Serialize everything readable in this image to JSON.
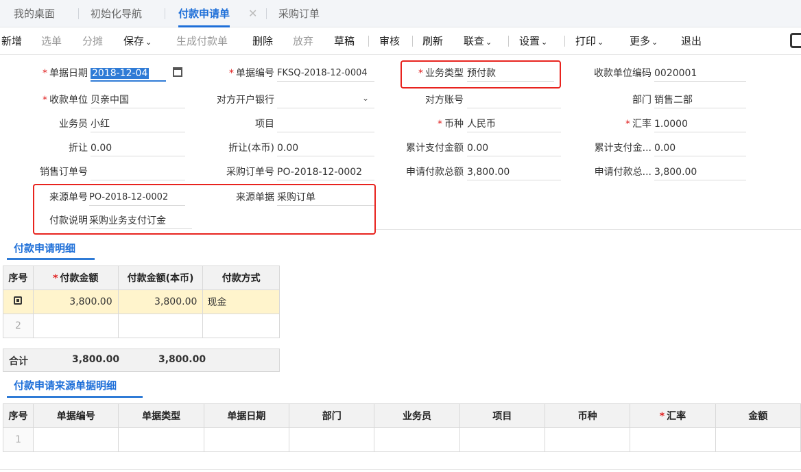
{
  "tabs": [
    {
      "label": "我的桌面"
    },
    {
      "label": "初始化导航"
    },
    {
      "label": "付款申请单"
    },
    {
      "label": "采购订单"
    }
  ],
  "tab_close_glyph": "✕",
  "toolbar": {
    "new": "新增",
    "select": "选单",
    "allocate": "分摊",
    "save": "保存",
    "gen_payment": "生成付款单",
    "delete": "删除",
    "discard": "放弃",
    "draft": "草稿",
    "audit": "审核",
    "refresh": "刷新",
    "link_query": "联查",
    "settings": "设置",
    "print": "打印",
    "more": "更多",
    "exit": "退出"
  },
  "caret": "⌄",
  "form": {
    "doc_date_label": "单据日期",
    "doc_date": "2018-12-04",
    "doc_no_label": "单据编号",
    "doc_no": "FKSQ-2018-12-0004",
    "biz_type_label": "业务类型",
    "biz_type": "预付款",
    "payee_code_label": "收款单位编码",
    "payee_code": "0020001",
    "payee_label": "收款单位",
    "payee": "贝亲中国",
    "bank_label": "对方开户银行",
    "bank": "",
    "account_label": "对方账号",
    "account": "",
    "dept_label": "部门",
    "dept": "销售二部",
    "salesman_label": "业务员",
    "salesman": "小红",
    "project_label": "项目",
    "project": "",
    "currency_label": "币种",
    "currency": "人民币",
    "rate_label": "汇率",
    "rate": "1.0000",
    "discount_label": "折让",
    "discount": "0.00",
    "discount_local_label": "折让(本币)",
    "discount_local": "0.00",
    "paid_total_label": "累计支付金额",
    "paid_total": "0.00",
    "paid_total_local_label": "累计支付金...",
    "paid_total_local": "0.00",
    "so_no_label": "销售订单号",
    "so_no": "",
    "po_no_label": "采购订单号",
    "po_no": "PO-2018-12-0002",
    "apply_total_label": "申请付款总额",
    "apply_total": "3,800.00",
    "apply_total_local_label": "申请付款总...",
    "apply_total_local": "3,800.00",
    "src_no_label": "来源单号",
    "src_no": "PO-2018-12-0002",
    "src_doc_label": "来源单据",
    "src_doc": "采购订单",
    "pay_note_label": "付款说明",
    "pay_note": "采购业务支付订金",
    "required_mark": "*"
  },
  "detail": {
    "title": "付款申请明细",
    "columns": [
      "序号",
      "付款金额",
      "付款金额(本币)",
      "付款方式"
    ],
    "rows": [
      {
        "seq": "",
        "amount": "3,800.00",
        "amount_local": "3,800.00",
        "method": "现金"
      },
      {
        "seq": "2",
        "amount": "",
        "amount_local": "",
        "method": ""
      }
    ],
    "sum_label": "合计",
    "sum_amount": "3,800.00",
    "sum_amount_local": "3,800.00"
  },
  "source": {
    "title": "付款申请来源单据明细",
    "columns": [
      "序号",
      "单据编号",
      "单据类型",
      "单据日期",
      "部门",
      "业务员",
      "项目",
      "币种",
      "汇率",
      "金额"
    ],
    "rows": [
      {
        "seq": "1"
      }
    ]
  },
  "colors": {
    "accent": "#1e6fd8",
    "highlight_box": "#e8231e",
    "row_highlight": "#fff4cc"
  }
}
